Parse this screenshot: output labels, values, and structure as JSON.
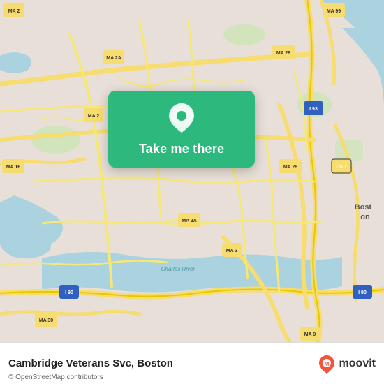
{
  "map": {
    "background_color": "#e4ddd5",
    "water_color": "#aad3df",
    "road_color": "#f7f0b0",
    "highway_color": "#f7dc6f"
  },
  "card": {
    "background_color": "#2db87d",
    "button_label": "Take me there",
    "pin_color": "#ffffff"
  },
  "bottom_bar": {
    "location_name": "Cambridge Veterans Svc, Boston",
    "copyright": "© OpenStreetMap contributors",
    "moovit_label": "moovit"
  }
}
